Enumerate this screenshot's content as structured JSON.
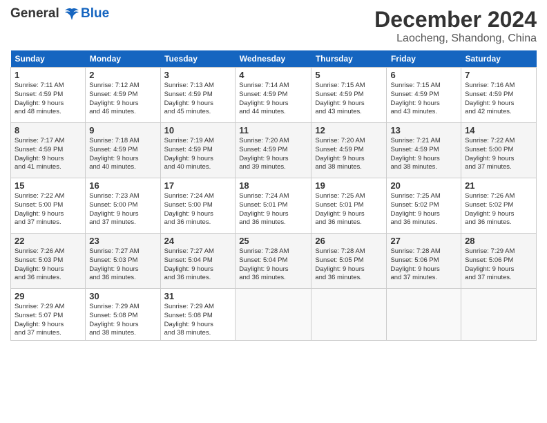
{
  "logo": {
    "line1": "General",
    "line2": "Blue"
  },
  "title": "December 2024",
  "location": "Laocheng, Shandong, China",
  "weekdays": [
    "Sunday",
    "Monday",
    "Tuesday",
    "Wednesday",
    "Thursday",
    "Friday",
    "Saturday"
  ],
  "weeks": [
    [
      {
        "day": "1",
        "sunrise": "7:11 AM",
        "sunset": "4:59 PM",
        "daylight": "9 hours and 48 minutes."
      },
      {
        "day": "2",
        "sunrise": "7:12 AM",
        "sunset": "4:59 PM",
        "daylight": "9 hours and 46 minutes."
      },
      {
        "day": "3",
        "sunrise": "7:13 AM",
        "sunset": "4:59 PM",
        "daylight": "9 hours and 45 minutes."
      },
      {
        "day": "4",
        "sunrise": "7:14 AM",
        "sunset": "4:59 PM",
        "daylight": "9 hours and 44 minutes."
      },
      {
        "day": "5",
        "sunrise": "7:15 AM",
        "sunset": "4:59 PM",
        "daylight": "9 hours and 43 minutes."
      },
      {
        "day": "6",
        "sunrise": "7:15 AM",
        "sunset": "4:59 PM",
        "daylight": "9 hours and 43 minutes."
      },
      {
        "day": "7",
        "sunrise": "7:16 AM",
        "sunset": "4:59 PM",
        "daylight": "9 hours and 42 minutes."
      }
    ],
    [
      {
        "day": "8",
        "sunrise": "7:17 AM",
        "sunset": "4:59 PM",
        "daylight": "9 hours and 41 minutes."
      },
      {
        "day": "9",
        "sunrise": "7:18 AM",
        "sunset": "4:59 PM",
        "daylight": "9 hours and 40 minutes."
      },
      {
        "day": "10",
        "sunrise": "7:19 AM",
        "sunset": "4:59 PM",
        "daylight": "9 hours and 40 minutes."
      },
      {
        "day": "11",
        "sunrise": "7:20 AM",
        "sunset": "4:59 PM",
        "daylight": "9 hours and 39 minutes."
      },
      {
        "day": "12",
        "sunrise": "7:20 AM",
        "sunset": "4:59 PM",
        "daylight": "9 hours and 38 minutes."
      },
      {
        "day": "13",
        "sunrise": "7:21 AM",
        "sunset": "4:59 PM",
        "daylight": "9 hours and 38 minutes."
      },
      {
        "day": "14",
        "sunrise": "7:22 AM",
        "sunset": "5:00 PM",
        "daylight": "9 hours and 37 minutes."
      }
    ],
    [
      {
        "day": "15",
        "sunrise": "7:22 AM",
        "sunset": "5:00 PM",
        "daylight": "9 hours and 37 minutes."
      },
      {
        "day": "16",
        "sunrise": "7:23 AM",
        "sunset": "5:00 PM",
        "daylight": "9 hours and 37 minutes."
      },
      {
        "day": "17",
        "sunrise": "7:24 AM",
        "sunset": "5:00 PM",
        "daylight": "9 hours and 36 minutes."
      },
      {
        "day": "18",
        "sunrise": "7:24 AM",
        "sunset": "5:01 PM",
        "daylight": "9 hours and 36 minutes."
      },
      {
        "day": "19",
        "sunrise": "7:25 AM",
        "sunset": "5:01 PM",
        "daylight": "9 hours and 36 minutes."
      },
      {
        "day": "20",
        "sunrise": "7:25 AM",
        "sunset": "5:02 PM",
        "daylight": "9 hours and 36 minutes."
      },
      {
        "day": "21",
        "sunrise": "7:26 AM",
        "sunset": "5:02 PM",
        "daylight": "9 hours and 36 minutes."
      }
    ],
    [
      {
        "day": "22",
        "sunrise": "7:26 AM",
        "sunset": "5:03 PM",
        "daylight": "9 hours and 36 minutes."
      },
      {
        "day": "23",
        "sunrise": "7:27 AM",
        "sunset": "5:03 PM",
        "daylight": "9 hours and 36 minutes."
      },
      {
        "day": "24",
        "sunrise": "7:27 AM",
        "sunset": "5:04 PM",
        "daylight": "9 hours and 36 minutes."
      },
      {
        "day": "25",
        "sunrise": "7:28 AM",
        "sunset": "5:04 PM",
        "daylight": "9 hours and 36 minutes."
      },
      {
        "day": "26",
        "sunrise": "7:28 AM",
        "sunset": "5:05 PM",
        "daylight": "9 hours and 36 minutes."
      },
      {
        "day": "27",
        "sunrise": "7:28 AM",
        "sunset": "5:06 PM",
        "daylight": "9 hours and 37 minutes."
      },
      {
        "day": "28",
        "sunrise": "7:29 AM",
        "sunset": "5:06 PM",
        "daylight": "9 hours and 37 minutes."
      }
    ],
    [
      {
        "day": "29",
        "sunrise": "7:29 AM",
        "sunset": "5:07 PM",
        "daylight": "9 hours and 37 minutes."
      },
      {
        "day": "30",
        "sunrise": "7:29 AM",
        "sunset": "5:08 PM",
        "daylight": "9 hours and 38 minutes."
      },
      {
        "day": "31",
        "sunrise": "7:29 AM",
        "sunset": "5:08 PM",
        "daylight": "9 hours and 38 minutes."
      },
      null,
      null,
      null,
      null
    ]
  ]
}
